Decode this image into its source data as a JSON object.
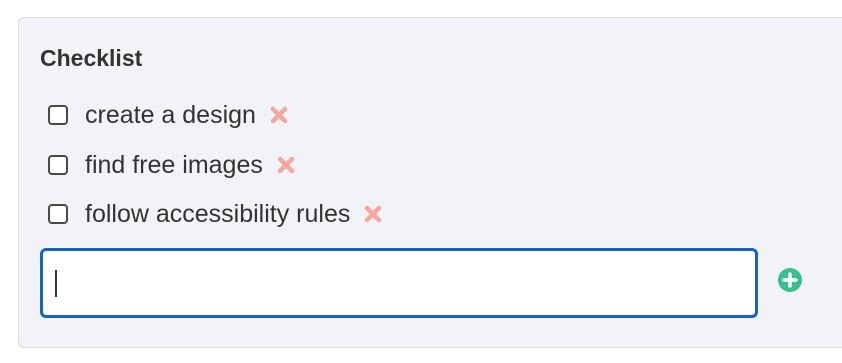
{
  "checklist": {
    "title": "Checklist",
    "items": [
      {
        "label": "create a design",
        "checked": false
      },
      {
        "label": "find free images",
        "checked": false
      },
      {
        "label": "follow accessibility rules",
        "checked": false
      }
    ],
    "new_item": {
      "value": "",
      "placeholder": ""
    }
  },
  "icons": {
    "delete": "close-icon",
    "add": "plus-circle-icon"
  },
  "colors": {
    "delete_icon": "#f4a79e",
    "add_icon": "#3cbf8f",
    "input_focus_border": "#1565c0",
    "panel_background": "#f2f3f7",
    "text": "#333333"
  }
}
